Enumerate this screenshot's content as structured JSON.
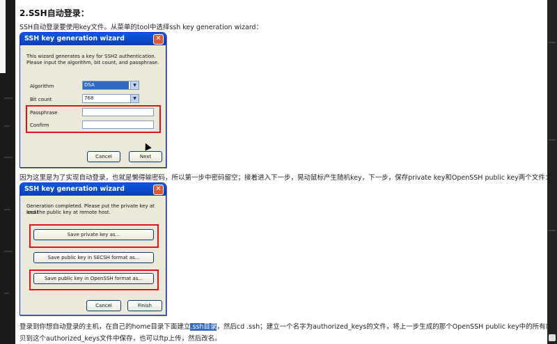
{
  "section_heading": "2.SSH自动登录：",
  "intro_text": "SSH自动登录要使用key文件。从菜单的tool中选择ssh key generation wizard：",
  "dialog1": {
    "title": "SSH key generation wizard",
    "description_line1": "This wizard generates a key for SSH2 authentication.",
    "description_line2": "Please input the algorithm, bit count, and passphrase.",
    "algorithm_label": "Algorithm",
    "algorithm_value": "DSA",
    "bitcount_label": "Bit count",
    "bitcount_value": "768",
    "passphrase_label": "Passphrase",
    "confirm_label": "Confirm",
    "cancel_label": "Cancel",
    "next_label": "Next"
  },
  "middle_text": "因为这里是为了实现自动登录，也就是懒得输密码，所以第一步中密码留空；接着进入下一步，晃动鼠标产生随机key，下一步，保存private key和OpenSSH public key两个文件：",
  "dialog2": {
    "title": "SSH key generation wizard",
    "description_line1": "Generation completed. Please put the private key at local",
    "description_line2": "and the public key at remote host.",
    "save_private_label": "Save private key as...",
    "save_public_secsh_label": "Save public key in SECSH format as...",
    "save_public_openssh_label": "Save public key in OpenSSH format as...",
    "cancel_label": "Cancel",
    "finish_label": "Finish"
  },
  "bottom_text_line1_part1": "登录到你想自动登录的主机，在自己的home目录下面建立",
  "bottom_text_highlight": ".ssh目录",
  "bottom_text_line1_part2": "，然后cd .ssh；建立一个名字为authorized_keys的文件，将上一步生成的那个OpenSSH public key中的所有内容拷",
  "bottom_text_line2": "贝到这个authorized_keys文件中保存，也可以ftp上传，然后改名。",
  "colors": {
    "titlebar": "#0b49c9",
    "dialog_bg": "#ece9d8",
    "highlight_box": "#e0151b",
    "selection": "#316ac5"
  }
}
